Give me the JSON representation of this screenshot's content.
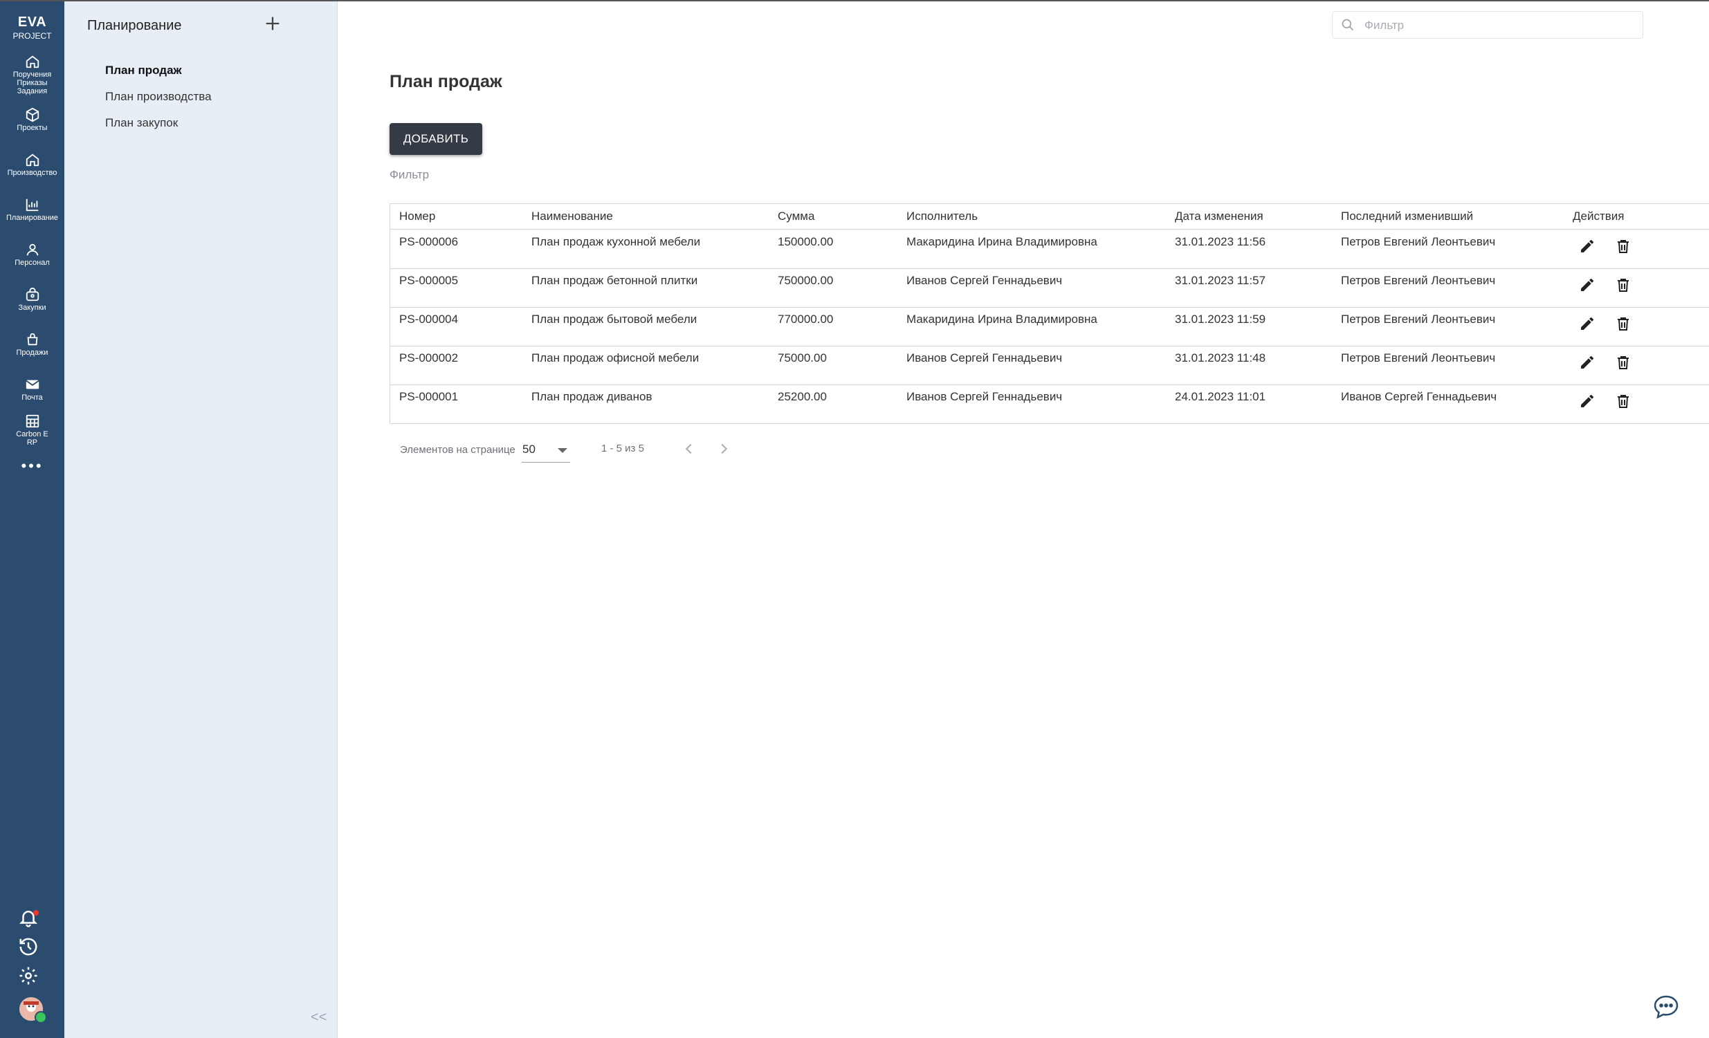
{
  "app": {
    "brand_line1": "EVA",
    "brand_line2": "PROJECT"
  },
  "rail": {
    "items": [
      {
        "label": "Поручения\nПриказы\nЗадания",
        "icon": "home-icon"
      },
      {
        "label": "Проекты",
        "icon": "cube-icon"
      },
      {
        "label": "Производство",
        "icon": "home-icon"
      },
      {
        "label": "Планирование",
        "icon": "chart-icon"
      },
      {
        "label": "Персонал",
        "icon": "person-icon"
      },
      {
        "label": "Закупки",
        "icon": "basket-icon"
      },
      {
        "label": "Продажи",
        "icon": "bag-icon"
      },
      {
        "label": "Почта",
        "icon": "mail-icon"
      },
      {
        "label": "Carbon E\nRP",
        "icon": "grid-icon"
      }
    ],
    "more": "•••"
  },
  "subnav": {
    "title": "Планирование",
    "items": [
      {
        "label": "План продаж",
        "active": true
      },
      {
        "label": "План производства",
        "active": false
      },
      {
        "label": "План закупок",
        "active": false
      }
    ],
    "collapse": "<<"
  },
  "search": {
    "placeholder": "Фильтр",
    "value": ""
  },
  "main": {
    "title": "План продаж",
    "add_button": "ДОБАВИТЬ",
    "filter_label": "Фильтр"
  },
  "table": {
    "columns": [
      "Номер",
      "Наименование",
      "Сумма",
      "Исполнитель",
      "Дата изменения",
      "Последний изменивший",
      "Действия"
    ],
    "rows": [
      [
        "PS-000006",
        "План продаж кухонной мебели",
        "150000.00",
        "Макаридина Ирина Владимировна",
        "31.01.2023 11:56",
        "Петров Евгений Леонтьевич"
      ],
      [
        "PS-000005",
        "План продаж бетонной плитки",
        "750000.00",
        "Иванов Сергей Геннадьевич",
        "31.01.2023 11:57",
        "Петров Евгений Леонтьевич"
      ],
      [
        "PS-000004",
        "План продаж бытовой мебели",
        "770000.00",
        "Макаридина Ирина Владимировна",
        "31.01.2023 11:59",
        "Петров Евгений Леонтьевич"
      ],
      [
        "PS-000002",
        "План продаж офисной мебели",
        "75000.00",
        "Иванов Сергей Геннадьевич",
        "31.01.2023 11:48",
        "Петров Евгений Леонтьевич"
      ],
      [
        "PS-000001",
        "План продаж диванов",
        "25200.00",
        "Иванов Сергей Геннадьевич",
        "24.01.2023 11:01",
        "Иванов Сергей Геннадьевич"
      ]
    ]
  },
  "pager": {
    "label": "Элементов на странице",
    "page_size": "50",
    "range": "1 - 5 из 5"
  },
  "colors": {
    "rail": "#2b4c6f",
    "subnav": "#e8eef6",
    "button": "#343a46",
    "notification": "#e53935",
    "online": "#3ac65c"
  }
}
